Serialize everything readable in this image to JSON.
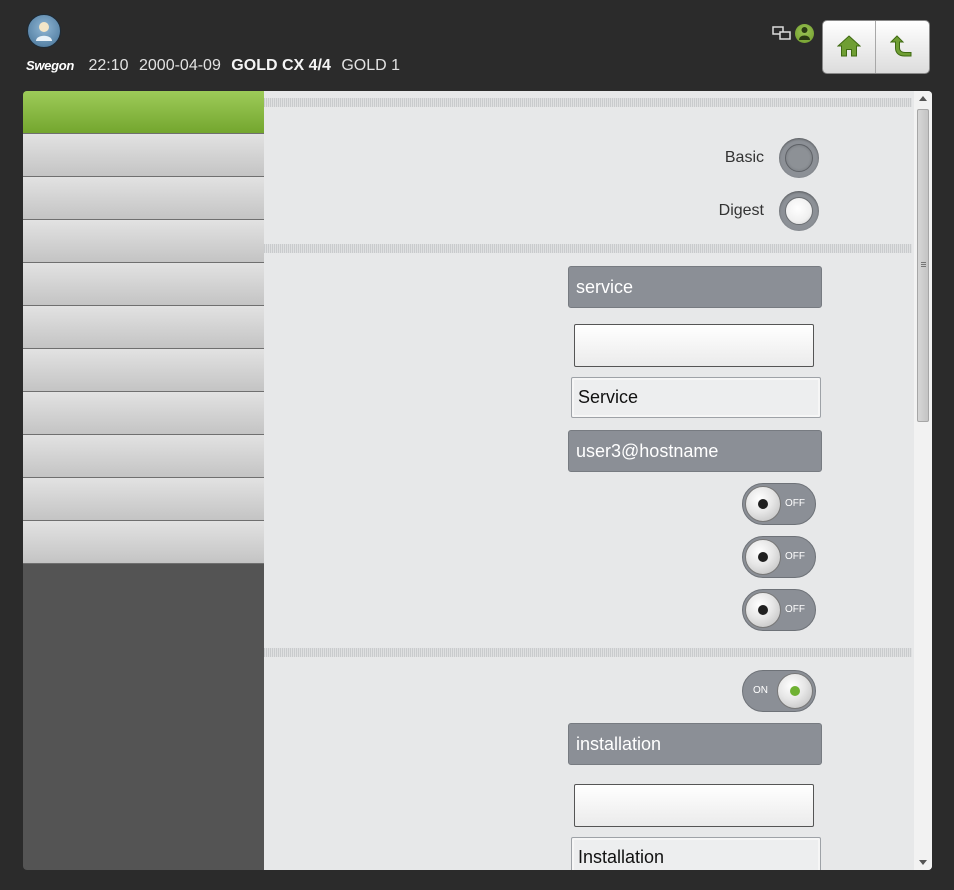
{
  "header": {
    "brand": "Swegon",
    "time": "22:10",
    "date": "2000-04-09",
    "unit": "GOLD CX 4/4",
    "unit_name": "GOLD 1",
    "icons": [
      "user-icon",
      "network-icon",
      "alarm-icon",
      "home-icon",
      "back-arrow-icon"
    ]
  },
  "sidebar": {
    "items": [
      {
        "label": "",
        "active": true
      },
      {
        "label": ""
      },
      {
        "label": ""
      },
      {
        "label": ""
      },
      {
        "label": ""
      },
      {
        "label": ""
      },
      {
        "label": ""
      },
      {
        "label": ""
      },
      {
        "label": ""
      },
      {
        "label": ""
      },
      {
        "label": ""
      }
    ]
  },
  "auth": {
    "basic_label": "Basic",
    "digest_label": "Digest",
    "selected": "Digest"
  },
  "service": {
    "username": "service",
    "password": "",
    "display_name": "Service",
    "login": "user3@hostname",
    "toggle1": "OFF",
    "toggle2": "OFF",
    "toggle3": "OFF"
  },
  "installation": {
    "enabled": "ON",
    "username": "installation",
    "password": "",
    "display_name": "Installation"
  },
  "colors": {
    "accent": "#7fb13a",
    "field_grey": "#8b8f96",
    "background": "#2b2b2b"
  }
}
